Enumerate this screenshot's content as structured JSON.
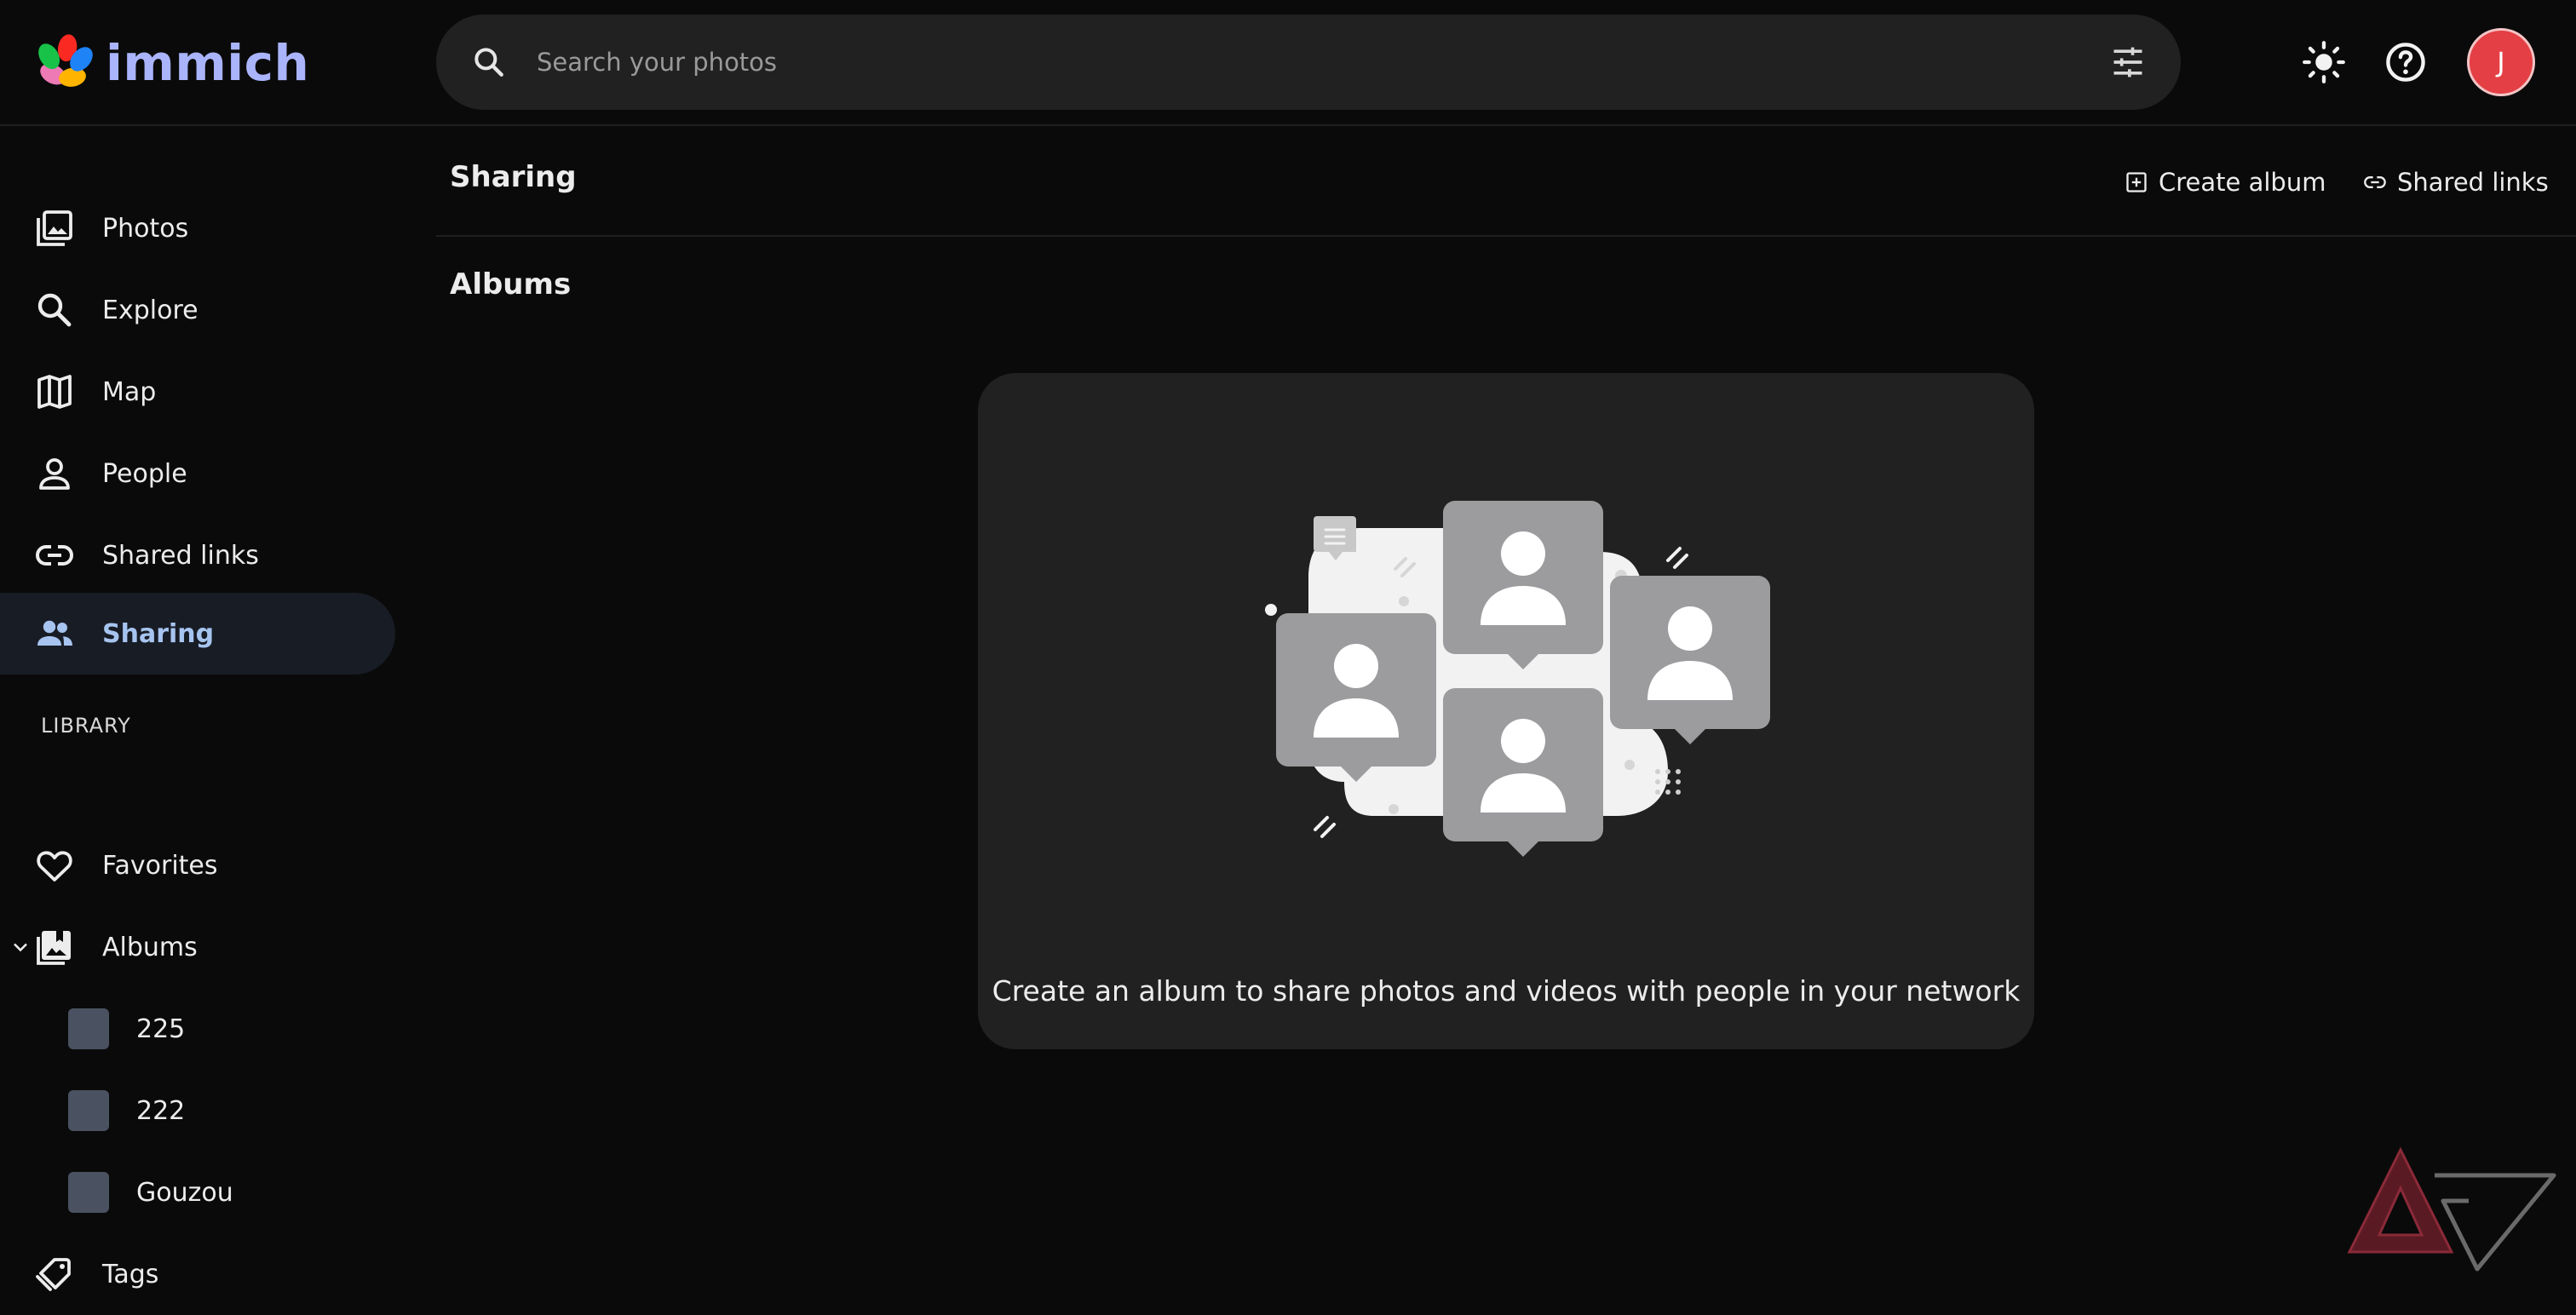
{
  "app": {
    "name": "immich",
    "logo_colors": [
      "#fa2921",
      "#ed79b5",
      "#ffb400",
      "#1e83f7",
      "#18c249"
    ]
  },
  "search": {
    "placeholder": "Search your photos"
  },
  "top_actions": {
    "theme_icon": "sun-icon",
    "help_icon": "help-circle-icon",
    "avatar_initial": "J",
    "avatar_color": "#e43f44"
  },
  "sidebar": {
    "items": [
      {
        "label": "Photos",
        "icon": "photos-icon"
      },
      {
        "label": "Explore",
        "icon": "magnify-icon"
      },
      {
        "label": "Map",
        "icon": "map-icon"
      },
      {
        "label": "People",
        "icon": "account-icon"
      },
      {
        "label": "Shared links",
        "icon": "link-icon"
      },
      {
        "label": "Sharing",
        "icon": "account-group-icon",
        "active": true
      }
    ],
    "library_heading": "LIBRARY",
    "library_items": [
      {
        "label": "Favorites",
        "icon": "heart-outline-icon"
      },
      {
        "label": "Albums",
        "icon": "album-image-icon",
        "expanded": true
      }
    ],
    "albums": [
      {
        "label": "225"
      },
      {
        "label": "222"
      },
      {
        "label": "Gouzou"
      }
    ],
    "tags_item": {
      "label": "Tags",
      "icon": "tag-multiple-icon"
    }
  },
  "main": {
    "page_title": "Sharing",
    "header_buttons": {
      "create_album": "Create album",
      "shared_links": "Shared links"
    },
    "section_title": "Albums",
    "empty_state_text": "Create an album to share photos and videos with people in your network"
  },
  "colors": {
    "background": "#0a0a0a",
    "surface": "#212121",
    "active_nav_bg": "#181c25",
    "active_nav_text": "#a6c4ef",
    "brand": "#aab4fb"
  }
}
